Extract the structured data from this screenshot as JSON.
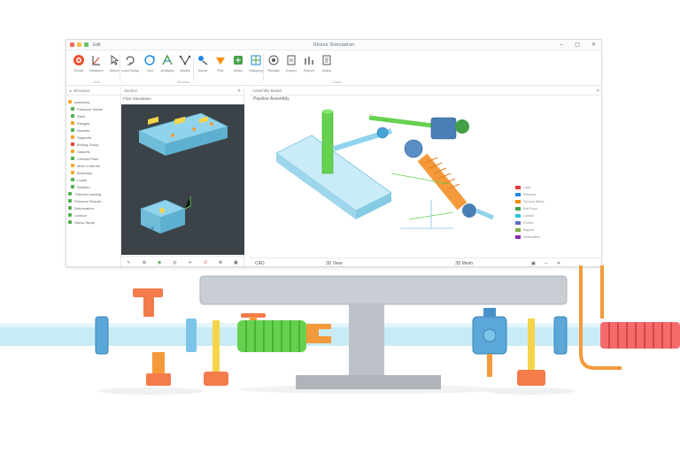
{
  "window": {
    "title": "Stress Simulation",
    "app_menu": "Edit",
    "controls": [
      "−",
      "□",
      "✕"
    ]
  },
  "ribbon": {
    "items": [
      {
        "label": "Reset",
        "icon": "reset-icon"
      },
      {
        "label": "Measure",
        "icon": "measure-icon"
      },
      {
        "label": "Select",
        "icon": "select-icon"
      },
      {
        "label": "Load Setup",
        "icon": "loop-icon"
      },
      {
        "label": "Tool",
        "icon": "cycle-icon"
      },
      {
        "label": "Analysis",
        "icon": "analysis-icon"
      },
      {
        "label": "Nodes",
        "icon": "nodes-icon"
      },
      {
        "label": "Solver",
        "icon": "solver-icon"
      },
      {
        "label": "Plot",
        "icon": "plot-icon"
      },
      {
        "label": "Mesh",
        "icon": "mesh-icon"
      },
      {
        "label": "Mapping",
        "icon": "map-icon"
      },
      {
        "label": "Results",
        "icon": "results-icon"
      },
      {
        "label": "Export",
        "icon": "export-icon"
      },
      {
        "label": "Report",
        "icon": "report-icon"
      },
      {
        "label": "Notes",
        "icon": "notes-icon"
      }
    ],
    "groups": [
      "Tools",
      "Simulate",
      "Output"
    ]
  },
  "tree": {
    "header": "Structure",
    "items": [
      {
        "label": "Assembly",
        "color": "#f5a623"
      },
      {
        "label": "Pressure Vessel",
        "color": "#4caf50"
      },
      {
        "label": "Shell",
        "color": "#4caf50"
      },
      {
        "label": "Flanges",
        "color": "#f5a623"
      },
      {
        "label": "Nozzles",
        "color": "#4caf50"
      },
      {
        "label": "Supports",
        "color": "#f5a623"
      },
      {
        "label": "Bolting Group",
        "color": "#e53935"
      },
      {
        "label": "Gaskets",
        "color": "#f5a623"
      },
      {
        "label": "Contact Pairs",
        "color": "#4caf50"
      },
      {
        "label": "Mesh Controls",
        "color": "#f5a623"
      },
      {
        "label": "Boundary",
        "color": "#f5a623"
      },
      {
        "label": "Loads",
        "color": "#4caf50"
      },
      {
        "label": "Solution",
        "color": "#4caf50"
      },
      {
        "label": "Thermal Loading",
        "color": "#4caf50"
      },
      {
        "label": "Pressure Results",
        "color": "#4caf50"
      },
      {
        "label": "Deformation",
        "color": "#4caf50"
      },
      {
        "label": "Contour",
        "color": "#4caf50"
      },
      {
        "label": "Stress Study",
        "color": "#4caf50"
      }
    ]
  },
  "viewport_left": {
    "header": "Section",
    "caption": "Flow Simulation",
    "tools": [
      "↖",
      "⊕",
      "◉",
      "◎",
      "⌖",
      "↺",
      "⚙",
      "▣"
    ]
  },
  "viewport_right": {
    "header": "Assembly Model",
    "caption": "Pipeline Assembly",
    "status": {
      "left": "CAD",
      "center": "3D View",
      "right": "3D Mesh"
    },
    "legend": [
      {
        "label": "Load",
        "color": "#e53935"
      },
      {
        "label": "Pressure",
        "color": "#1e88e5"
      },
      {
        "label": "Thermal Stress",
        "color": "#fb8c00"
      },
      {
        "label": "Bolt Force",
        "color": "#43a047"
      },
      {
        "label": "Contact",
        "color": "#26c6da"
      },
      {
        "label": "Friction",
        "color": "#5c6bc0"
      },
      {
        "label": "Support",
        "color": "#7cb342"
      },
      {
        "label": "Deformation",
        "color": "#8e24aa"
      }
    ]
  },
  "colors": {
    "accent_blue": "#8fd4ec",
    "accent_green": "#66d14f",
    "accent_orange": "#f59a3b",
    "dark_canvas": "#3b4248"
  }
}
